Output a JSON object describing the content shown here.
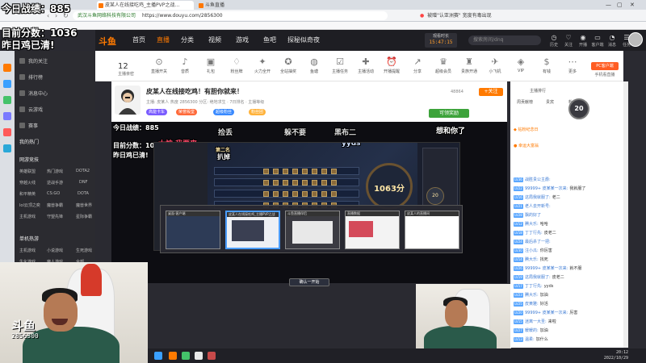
{
  "browser": {
    "tabs": [
      {
        "label": "今日战绩："
      },
      {
        "label": "皮某人在线接吃鸡_主播PVP之战…"
      },
      {
        "label": "斗鱼直播"
      }
    ],
    "url_site": "武汉斗鱼网络科技有限公司",
    "url": "https://www.douyu.com/2856300",
    "right_text": "被赠\"认亚洲赛\" 宽度有毒出现"
  },
  "overlay": {
    "today_label": "今日战绩：",
    "today_value": "885",
    "score_label": "目前分数：",
    "score_value": "1036",
    "yesterday": "昨日鸡已清!",
    "video_today": "今日战绩：885",
    "video_score": "目前分数：1036",
    "video_yesterday": "昨日鸡已清!",
    "game_text_1": "捡丢",
    "game_text_2": "扒掉",
    "game_text_3": "躲不要",
    "game_text_4": "黑布二",
    "game_text_5": "想和你了",
    "game_red": "大神 我要来",
    "watermark_logo": "斗鱼",
    "watermark_room": "2856300"
  },
  "site": {
    "logo": "斗鱼",
    "nav": [
      "首页",
      "直播",
      "分类",
      "视频",
      "游戏",
      "鱼吧",
      "探秘似奇夜"
    ],
    "clock_label": "观看时长",
    "clock_value": "15:47:15",
    "search_placeholder": "搜索房间/dnq",
    "header_icons": [
      "历史",
      "关注",
      "开播",
      "客户端",
      "消息",
      "任务"
    ]
  },
  "toolbar": {
    "first_value": "12",
    "first_label": "主播亲密",
    "items": [
      "直播开关",
      "音质",
      "礼包",
      "粉丝牌",
      "火力全开",
      "全站抽奖",
      "鱼塘",
      "主播任务",
      "主播活动",
      "开播提醒",
      "分享",
      "超级会员",
      "贵族开通",
      "小飞机",
      "VIP",
      "有钱",
      "更多"
    ],
    "pc_label": "PC客户端",
    "phone_label": "手机看直播"
  },
  "sidebar": {
    "items": [
      "我的关注",
      "排行榜",
      "消息中心",
      "云游戏",
      "赛事"
    ],
    "section_label": "我的热门",
    "section2_label": "网游竞技",
    "grid": [
      "英雄联盟",
      "热门游戏",
      "DOTA2",
      "穿越火线",
      "逆战手游",
      "DNF",
      "和平精英",
      "CS:GO",
      "DOTA",
      "lol云顶之奕",
      "魔兽争霸",
      "魔兽世界",
      "主机游戏",
      "守望先锋",
      "星际争霸"
    ],
    "section3_label": "单机热游",
    "grid2": [
      "主机游戏",
      "小说游戏",
      "生死游戏",
      "生化游戏",
      "魔人游戏",
      "全部"
    ]
  },
  "room": {
    "title": "皮某人在线接吃鸡！有胆你就来！",
    "sub": "主播: 皮某人  热度 2856300  分区: 绝地求生 · 7日排名 · 主播等级",
    "tags": [
      "高能卡车",
      "荣誉殿堂",
      "超级粉丝",
      "粉丝团"
    ],
    "follow": "+关注",
    "count": "48864",
    "green_btn": "可领奖励"
  },
  "game": {
    "panel_title": "第二名",
    "score_value": "1063分",
    "ring": "20",
    "window_caption": "yyds",
    "bottom_btn": "确认一开始"
  },
  "switcher": {
    "thumbs": [
      {
        "caption": "桌面-客户端"
      },
      {
        "caption": "皮某人在线接吃鸡_主播PVP之战"
      },
      {
        "caption": "斗鱼直播伴侣"
      },
      {
        "caption": "直播数据"
      },
      {
        "caption": "皮某人的直播间"
      }
    ]
  },
  "chat": {
    "tabs": [
      "主播排行",
      "周贡献榜",
      "贵宾",
      "粉丝团"
    ],
    "score_ring": "20",
    "rank_items": [
      "钻粉纪念日",
      "幸运大富翁"
    ],
    "messages": [
      {
        "level": "LV36",
        "nick": "战胜贵公主爵:",
        "text": ""
      },
      {
        "level": "LV22",
        "nick": "99999+ 皮某某一次来:",
        "text": "我就服了"
      },
      {
        "level": "LV16",
        "nick": "这局我就服了:",
        "text": "老二"
      },
      {
        "level": "LV21",
        "nick": "老人去开新号:",
        "text": ""
      },
      {
        "level": "LV28",
        "nick": "飘的好了",
        "text": ""
      },
      {
        "level": "LV12",
        "nick": "腾大乐:",
        "text": "哈哈"
      },
      {
        "level": "LV18",
        "nick": "丁丁行先:",
        "text": "皮老二"
      },
      {
        "level": "LV24",
        "nick": "最后杀了一把:",
        "text": ""
      },
      {
        "level": "LV30",
        "nick": "注小瓜:",
        "text": "你厉害"
      },
      {
        "level": "LV14",
        "nick": "腾大乐:",
        "text": "找死"
      },
      {
        "level": "LV26",
        "nick": "99999+ 皮某某一次来:",
        "text": "就不服"
      },
      {
        "level": "LV19",
        "nick": "这局我就服了:",
        "text": "皮老二"
      },
      {
        "level": "LV17",
        "nick": "丁丁行先:",
        "text": "yyds"
      },
      {
        "level": "LV23",
        "nick": "腾大乐:",
        "text": "加油"
      },
      {
        "level": "LV25",
        "nick": "皮黄雅:",
        "text": "好活"
      },
      {
        "level": "LV20",
        "nick": "99999+ 皮某某一次来:",
        "text": "厉害"
      },
      {
        "level": "LV15",
        "nick": "迷离一大圣:",
        "text": "来啦"
      },
      {
        "level": "LV27",
        "nick": "暖暖的:",
        "text": "加油"
      },
      {
        "level": "LV13",
        "nick": "温柔:",
        "text": "加什么"
      }
    ]
  },
  "taskbar": {
    "time": "20:12",
    "date": "2022/10/29"
  },
  "colors": {
    "brand": "#ff7a00",
    "header_bg": "#1e1e23",
    "accent_green": "#3da33b"
  }
}
